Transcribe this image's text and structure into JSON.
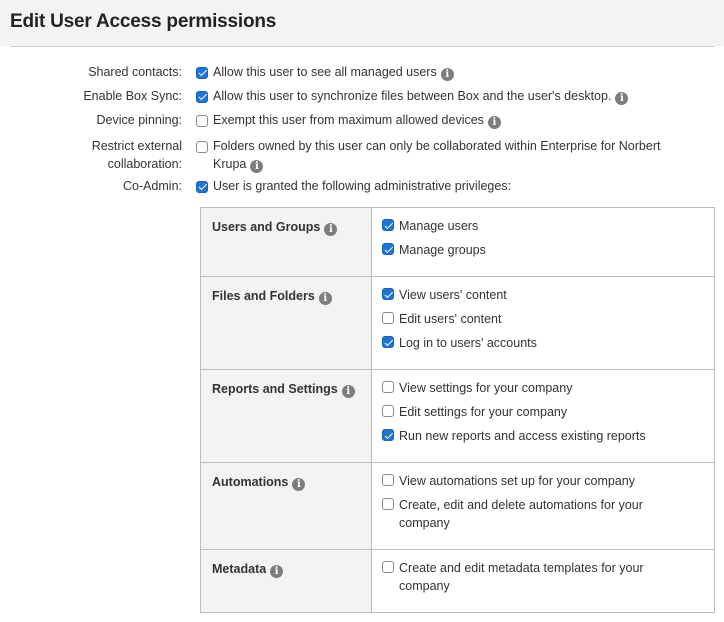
{
  "page": {
    "title": "Edit User Access permissions"
  },
  "settings": [
    {
      "label": "Shared contacts:",
      "text": "Allow this user to see all managed users",
      "checked": true,
      "info": true
    },
    {
      "label": "Enable Box Sync:",
      "text": "Allow this user to synchronize files between Box and the user's desktop.",
      "checked": true,
      "info": true
    },
    {
      "label": "Device pinning:",
      "text": "Exempt this user from maximum allowed devices",
      "checked": false,
      "info": true
    },
    {
      "label": "Restrict external collaboration:",
      "text": "Folders owned by this user can only be collaborated within Enterprise for Norbert Krupa",
      "checked": false,
      "info": true
    },
    {
      "label": "Co-Admin:",
      "text": "User is granted the following administrative privileges:",
      "checked": true,
      "info": false
    }
  ],
  "privileges": [
    {
      "category": "Users and Groups",
      "options": [
        {
          "label": "Manage users",
          "checked": true
        },
        {
          "label": "Manage groups",
          "checked": true
        }
      ]
    },
    {
      "category": "Files and Folders",
      "options": [
        {
          "label": "View users' content",
          "checked": true
        },
        {
          "label": "Edit users' content",
          "checked": false
        },
        {
          "label": "Log in to users' accounts",
          "checked": true
        }
      ]
    },
    {
      "category": "Reports and Settings",
      "options": [
        {
          "label": "View settings for your company",
          "checked": false
        },
        {
          "label": "Edit settings for your company",
          "checked": false
        },
        {
          "label": "Run new reports and access existing reports",
          "checked": true
        }
      ]
    },
    {
      "category": "Automations",
      "options": [
        {
          "label": "View automations set up for your company",
          "checked": false
        },
        {
          "label": "Create, edit and delete automations for your company",
          "checked": false
        }
      ]
    },
    {
      "category": "Metadata",
      "options": [
        {
          "label": "Create and edit metadata templates for your company",
          "checked": false
        }
      ]
    }
  ],
  "icons": {
    "info": "info-circle-icon",
    "check": "checkmark-icon"
  },
  "colors": {
    "checkbox_checked": "#1f74d6",
    "header_background": "#f3f3f3",
    "info_icon": "#7d7d7d"
  }
}
